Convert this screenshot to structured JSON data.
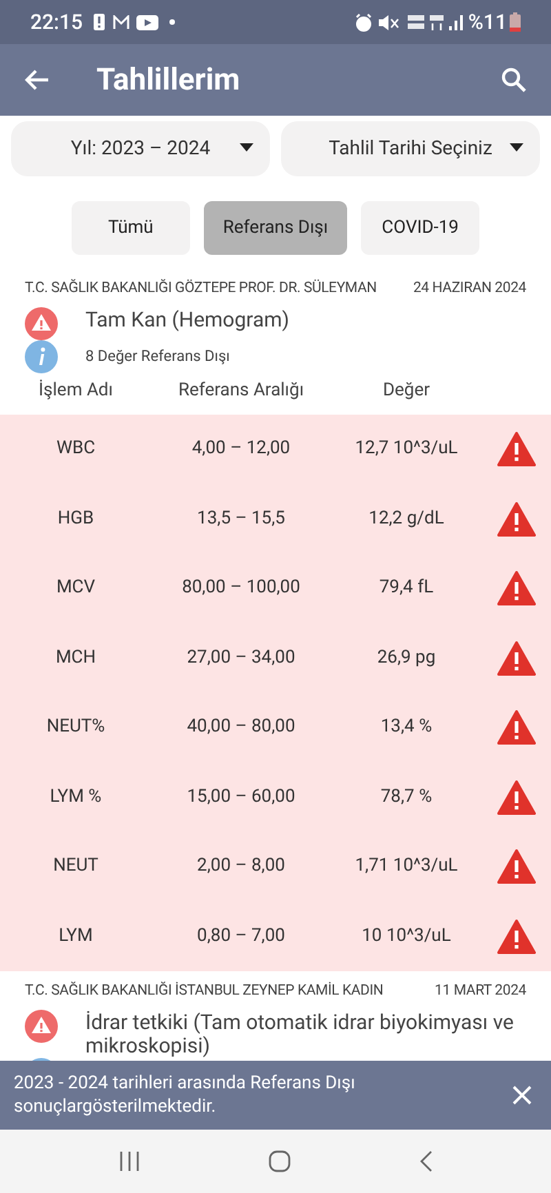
{
  "status_bar": {
    "time": "22:15",
    "battery": "%11"
  },
  "app_bar": {
    "title": "Tahlillerim"
  },
  "dropdowns": [
    {
      "label": "Yıl: 2023 – 2024"
    },
    {
      "label": "Tahlil Tarihi Seçiniz"
    }
  ],
  "filters": [
    {
      "label": "Tümü",
      "selected": false
    },
    {
      "label": "Referans Dışı",
      "selected": true
    },
    {
      "label": "COVID-19",
      "selected": false
    }
  ],
  "results": [
    {
      "hospital": "T.C. SAĞLIK BAKANLIĞI GÖZTEPE PROF. DR. SÜLEYMAN",
      "date": "24 HAZIRAN 2024",
      "test": "Tam Kan (Hemogram)",
      "summary": "8 Değer Referans Dışı",
      "columns": [
        "İşlem Adı",
        "Referans Aralığı",
        "Değer"
      ],
      "rows": [
        {
          "name": "WBC",
          "range": "4,00 – 12,00",
          "value": "12,7 10^3/uL",
          "out_of_range": true
        },
        {
          "name": "HGB",
          "range": "13,5 – 15,5",
          "value": "12,2 g/dL",
          "out_of_range": true
        },
        {
          "name": "MCV",
          "range": "80,00 – 100,00",
          "value": "79,4 fL",
          "out_of_range": true
        },
        {
          "name": "MCH",
          "range": "27,00 – 34,00",
          "value": "26,9 pg",
          "out_of_range": true
        },
        {
          "name": "NEUT%",
          "range": "40,00 – 80,00",
          "value": "13,4 %",
          "out_of_range": true
        },
        {
          "name": "LYM %",
          "range": "15,00 – 60,00",
          "value": "78,7 %",
          "out_of_range": true
        },
        {
          "name": "NEUT",
          "range": "2,00 – 8,00",
          "value": "1,71 10^3/uL",
          "out_of_range": true
        },
        {
          "name": "LYM",
          "range": "0,80 – 7,00",
          "value": "10 10^3/uL",
          "out_of_range": true
        }
      ]
    },
    {
      "hospital": "T.C. SAĞLIK BAKANLIĞI İSTANBUL ZEYNEP KAMİL KADIN",
      "date": "11 MART 2024",
      "test": "İdrar tetkiki (Tam otomatik idrar biyokimyası ve mikroskopisi)"
    }
  ],
  "snackbar": {
    "message": "2023 - 2024 tarihleri arasında Referans Dışı sonuçlargösterilmektedir."
  }
}
